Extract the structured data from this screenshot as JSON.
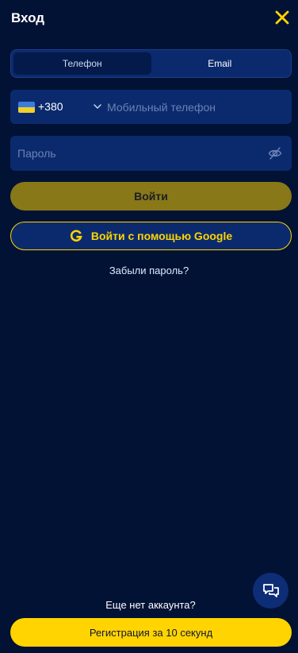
{
  "header": {
    "title": "Вход",
    "close_icon": "close-icon",
    "accent_color": "#ffd400"
  },
  "tabs": [
    {
      "label": "Телефон",
      "active": true
    },
    {
      "label": "Email",
      "active": false
    }
  ],
  "phone": {
    "country_flag": "ukraine-flag-icon",
    "dial_code": "+380",
    "chevron_icon": "chevron-down-icon",
    "placeholder": "Мобильный телефон",
    "value": ""
  },
  "password": {
    "placeholder": "Пароль",
    "value": "",
    "toggle_icon": "eye-hidden-icon"
  },
  "login": {
    "label": "Войти"
  },
  "google": {
    "label": "Войти с помощью Google",
    "icon": "google-icon"
  },
  "forgot": {
    "label": "Забыли пароль?"
  },
  "chat": {
    "icon": "chat-bubbles-icon"
  },
  "footer": {
    "no_account": "Еще нет аккаунта?",
    "register_label": "Регистрация за 10 секунд"
  },
  "colors": {
    "background": "#021234",
    "field": "#0b2a6e",
    "accent": "#ffd400",
    "login_disabled": "#887817"
  }
}
